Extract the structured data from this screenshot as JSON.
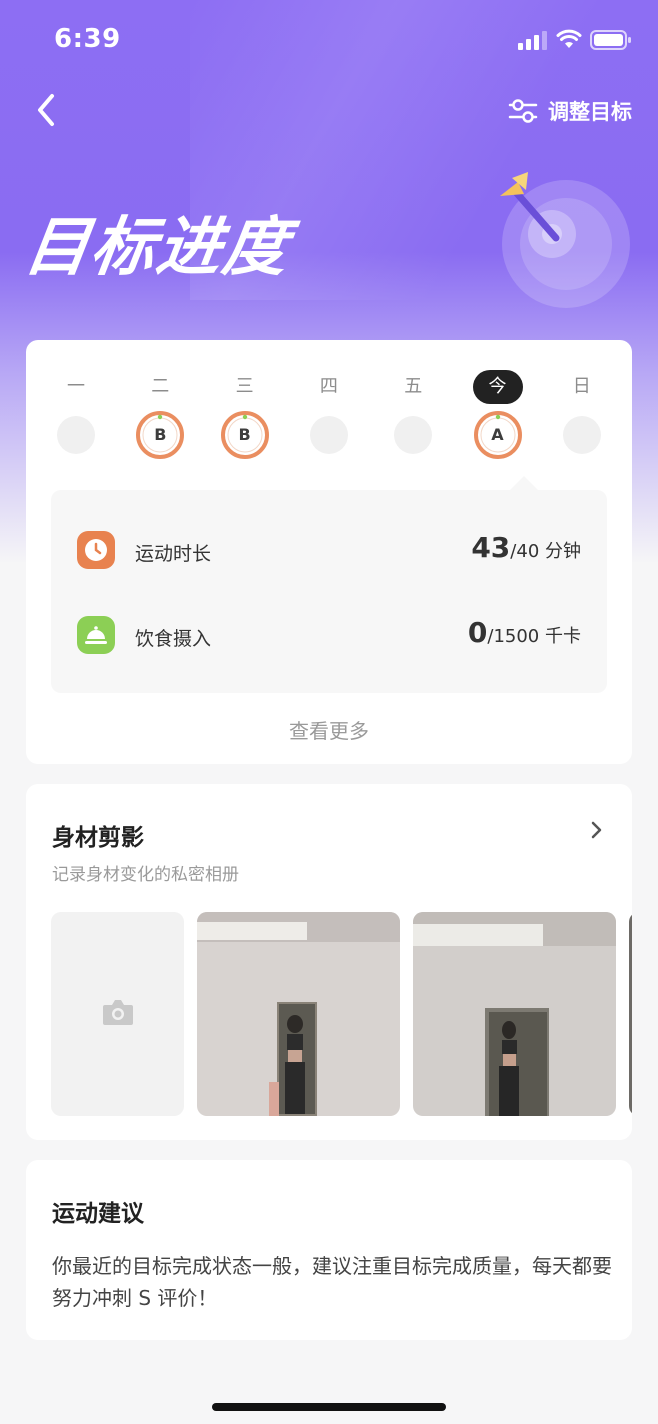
{
  "status_bar": {
    "time": "6:39"
  },
  "header": {
    "adjust_label": "调整目标",
    "title": "目标进度"
  },
  "week": {
    "days": [
      {
        "label": "一",
        "grade": "",
        "today": false
      },
      {
        "label": "二",
        "grade": "B",
        "today": false
      },
      {
        "label": "三",
        "grade": "B",
        "today": false
      },
      {
        "label": "四",
        "grade": "",
        "today": false
      },
      {
        "label": "五",
        "grade": "",
        "today": false
      },
      {
        "label": "今",
        "grade": "A",
        "today": true
      },
      {
        "label": "日",
        "grade": "",
        "today": false
      }
    ],
    "stats": [
      {
        "name": "运动时长",
        "value": "43",
        "target": "/40 分钟",
        "icon": "clock-icon",
        "color": "#e8824f"
      },
      {
        "name": "饮食摄入",
        "value": "0",
        "target": "/1500 千卡",
        "icon": "dish-icon",
        "color": "#8ccf55"
      }
    ],
    "more_label": "查看更多"
  },
  "body_album": {
    "title": "身材剪影",
    "subtitle": "记录身材变化的私密相册"
  },
  "advice": {
    "title": "运动建议",
    "text": "你最近的目标完成状态一般，建议注重目标完成质量，每天都要努力冲刺 S 评价！"
  },
  "colors": {
    "accent": "#8a6cf2",
    "ring": "#e8824f"
  }
}
